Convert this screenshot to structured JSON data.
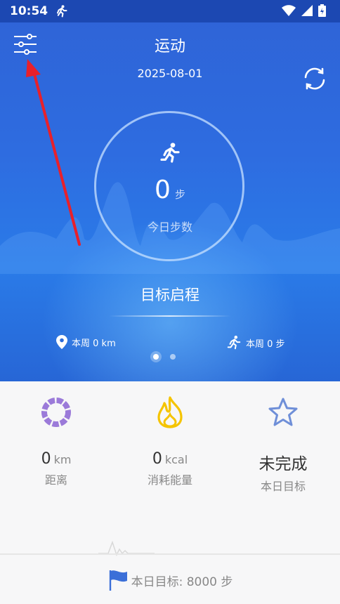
{
  "status_bar": {
    "time": "10:54"
  },
  "header": {
    "title": "运动",
    "date": "2025-08-01"
  },
  "today": {
    "steps": "0",
    "steps_unit": "步",
    "label": "今日步数"
  },
  "goal_start_label": "目标启程",
  "weekly": {
    "distance_label": "本周 0 km",
    "steps_label": "本周 0 步"
  },
  "pager": {
    "current": 1,
    "total": 2
  },
  "stats": {
    "distance": {
      "value": "0",
      "unit": "km",
      "label": "距离"
    },
    "calories": {
      "value": "0",
      "unit": "kcal",
      "label": "消耗能量"
    },
    "goal": {
      "value": "未完成",
      "label": "本日目标"
    }
  },
  "footer": {
    "goal_text": "本日目标: 8000 步"
  },
  "colors": {
    "hero_blue": "#2e6ce0",
    "distance_purple": "#9b7ad9",
    "calorie_yellow": "#f5c400",
    "goal_blue": "#6f8fd8",
    "annotation_red": "#e8202a"
  },
  "icons": [
    "filter-settings-icon",
    "sync-icon",
    "runner-icon",
    "location-pin-icon",
    "ring-icon",
    "flame-icon",
    "star-icon",
    "flag-icon"
  ]
}
